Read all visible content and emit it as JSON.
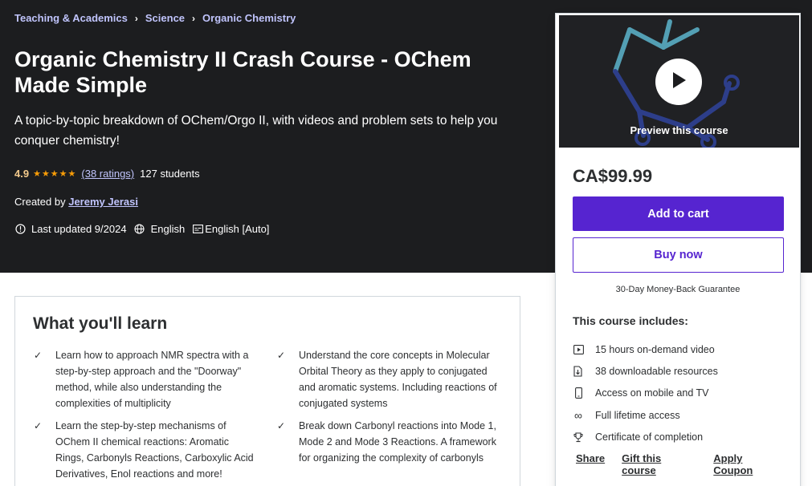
{
  "breadcrumb": [
    "Teaching & Academics",
    "Science",
    "Organic Chemistry"
  ],
  "course": {
    "title": "Organic Chemistry II Crash Course - OChem Made Simple",
    "subtitle": "A topic-by-topic breakdown of OChem/Orgo II, with videos and problem sets to help you conquer chemistry!",
    "rating": "4.9",
    "stars": "★★★★★",
    "ratings_count": "(38 ratings)",
    "students": "127 students",
    "created_by_label": "Created by",
    "author": "Jeremy Jerasi",
    "last_updated": "Last updated 9/2024",
    "language": "English",
    "captions": "English [Auto]"
  },
  "sidebar": {
    "preview_label": "Preview this course",
    "price": "CA$99.99",
    "add_to_cart": "Add to cart",
    "buy_now": "Buy now",
    "guarantee": "30-Day Money-Back Guarantee",
    "includes_title": "This course includes:",
    "includes": [
      {
        "icon": "video-icon",
        "text": "15 hours on-demand video"
      },
      {
        "icon": "file-download-icon",
        "text": "38 downloadable resources"
      },
      {
        "icon": "mobile-icon",
        "text": "Access on mobile and TV"
      },
      {
        "icon": "infinity-icon",
        "text": "Full lifetime access"
      },
      {
        "icon": "trophy-icon",
        "text": "Certificate of completion"
      }
    ],
    "share": "Share",
    "gift": "Gift this course",
    "coupon": "Apply Coupon"
  },
  "learn": {
    "title": "What you'll learn",
    "items": [
      "Learn how to approach NMR spectra with a step-by-step approach and the \"Doorway\" method, while also understanding the complexities of multiplicity",
      "Understand the core concepts in Molecular Orbital Theory as they apply to conjugated and aromatic systems. Including reactions of conjugated systems",
      "Learn the step-by-step mechanisms of OChem II chemical reactions: Aromatic Rings, Carbonyls Reactions, Carboxylic Acid Derivatives, Enol reactions and more!",
      "Break down Carbonyl reactions into Mode 1, Mode 2 and Mode 3 Reactions. A framework for organizing the complexity of carbonyls"
    ]
  },
  "colors": {
    "hero_bg": "#1c1d1f",
    "accent": "#5624d0",
    "link_light": "#c0c4fc",
    "rating": "#f3ca8c",
    "star": "#f69c08"
  }
}
